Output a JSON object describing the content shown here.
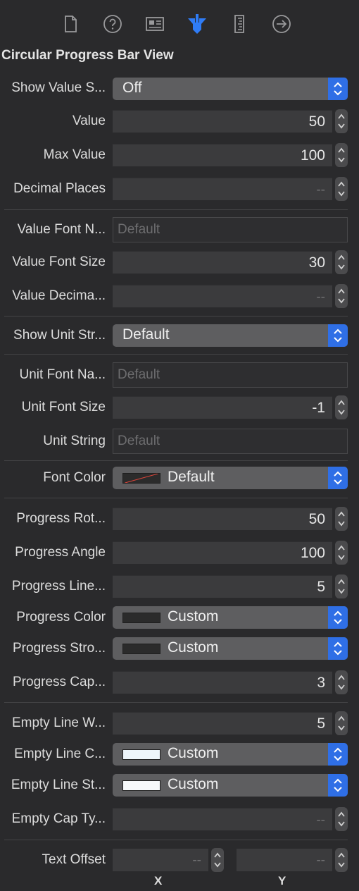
{
  "section_title": "Circular Progress Bar View",
  "rows": {
    "show_value_string": {
      "label": "Show Value S...",
      "value": "Off"
    },
    "value": {
      "label": "Value",
      "value": "50"
    },
    "max_value": {
      "label": "Max Value",
      "value": "100"
    },
    "decimal_places": {
      "label": "Decimal Places",
      "value": "--"
    },
    "value_font_name": {
      "label": "Value Font N...",
      "placeholder": "Default"
    },
    "value_font_size": {
      "label": "Value Font Size",
      "value": "30"
    },
    "value_decimal": {
      "label": "Value Decima...",
      "value": "--"
    },
    "show_unit_string": {
      "label": "Show Unit Str...",
      "value": "Default"
    },
    "unit_font_name": {
      "label": "Unit Font Na...",
      "placeholder": "Default"
    },
    "unit_font_size": {
      "label": "Unit Font Size",
      "value": "-1"
    },
    "unit_string": {
      "label": "Unit String",
      "placeholder": "Default"
    },
    "font_color": {
      "label": "Font Color",
      "value": "Default"
    },
    "progress_rotation": {
      "label": "Progress Rot...",
      "value": "50"
    },
    "progress_angle": {
      "label": "Progress Angle",
      "value": "100"
    },
    "progress_line_width": {
      "label": "Progress Line...",
      "value": "5"
    },
    "progress_color": {
      "label": "Progress Color",
      "value": "Custom",
      "swatch": "#2b2b2b"
    },
    "progress_stroke_color": {
      "label": "Progress Stro...",
      "value": "Custom",
      "swatch": "#2b2b2b"
    },
    "progress_cap_type": {
      "label": "Progress Cap...",
      "value": "3"
    },
    "empty_line_width": {
      "label": "Empty Line W...",
      "value": "5"
    },
    "empty_line_color": {
      "label": "Empty Line C...",
      "value": "Custom",
      "swatch": "#eef6fb"
    },
    "empty_line_stroke_color": {
      "label": "Empty Line St...",
      "value": "Custom",
      "swatch": "#f7f9fa"
    },
    "empty_cap_type": {
      "label": "Empty Cap Ty...",
      "value": "--"
    },
    "text_offset": {
      "label": "Text Offset",
      "x_value": "--",
      "y_value": "--",
      "x_label": "X",
      "y_label": "Y"
    }
  },
  "colors": {
    "accent": "#2f6fe6",
    "background": "#2a2a2c"
  },
  "toolbar_icons": [
    "file-inspector-icon",
    "help-icon",
    "identity-inspector-icon",
    "attributes-inspector-icon",
    "size-inspector-icon",
    "connections-inspector-icon"
  ]
}
